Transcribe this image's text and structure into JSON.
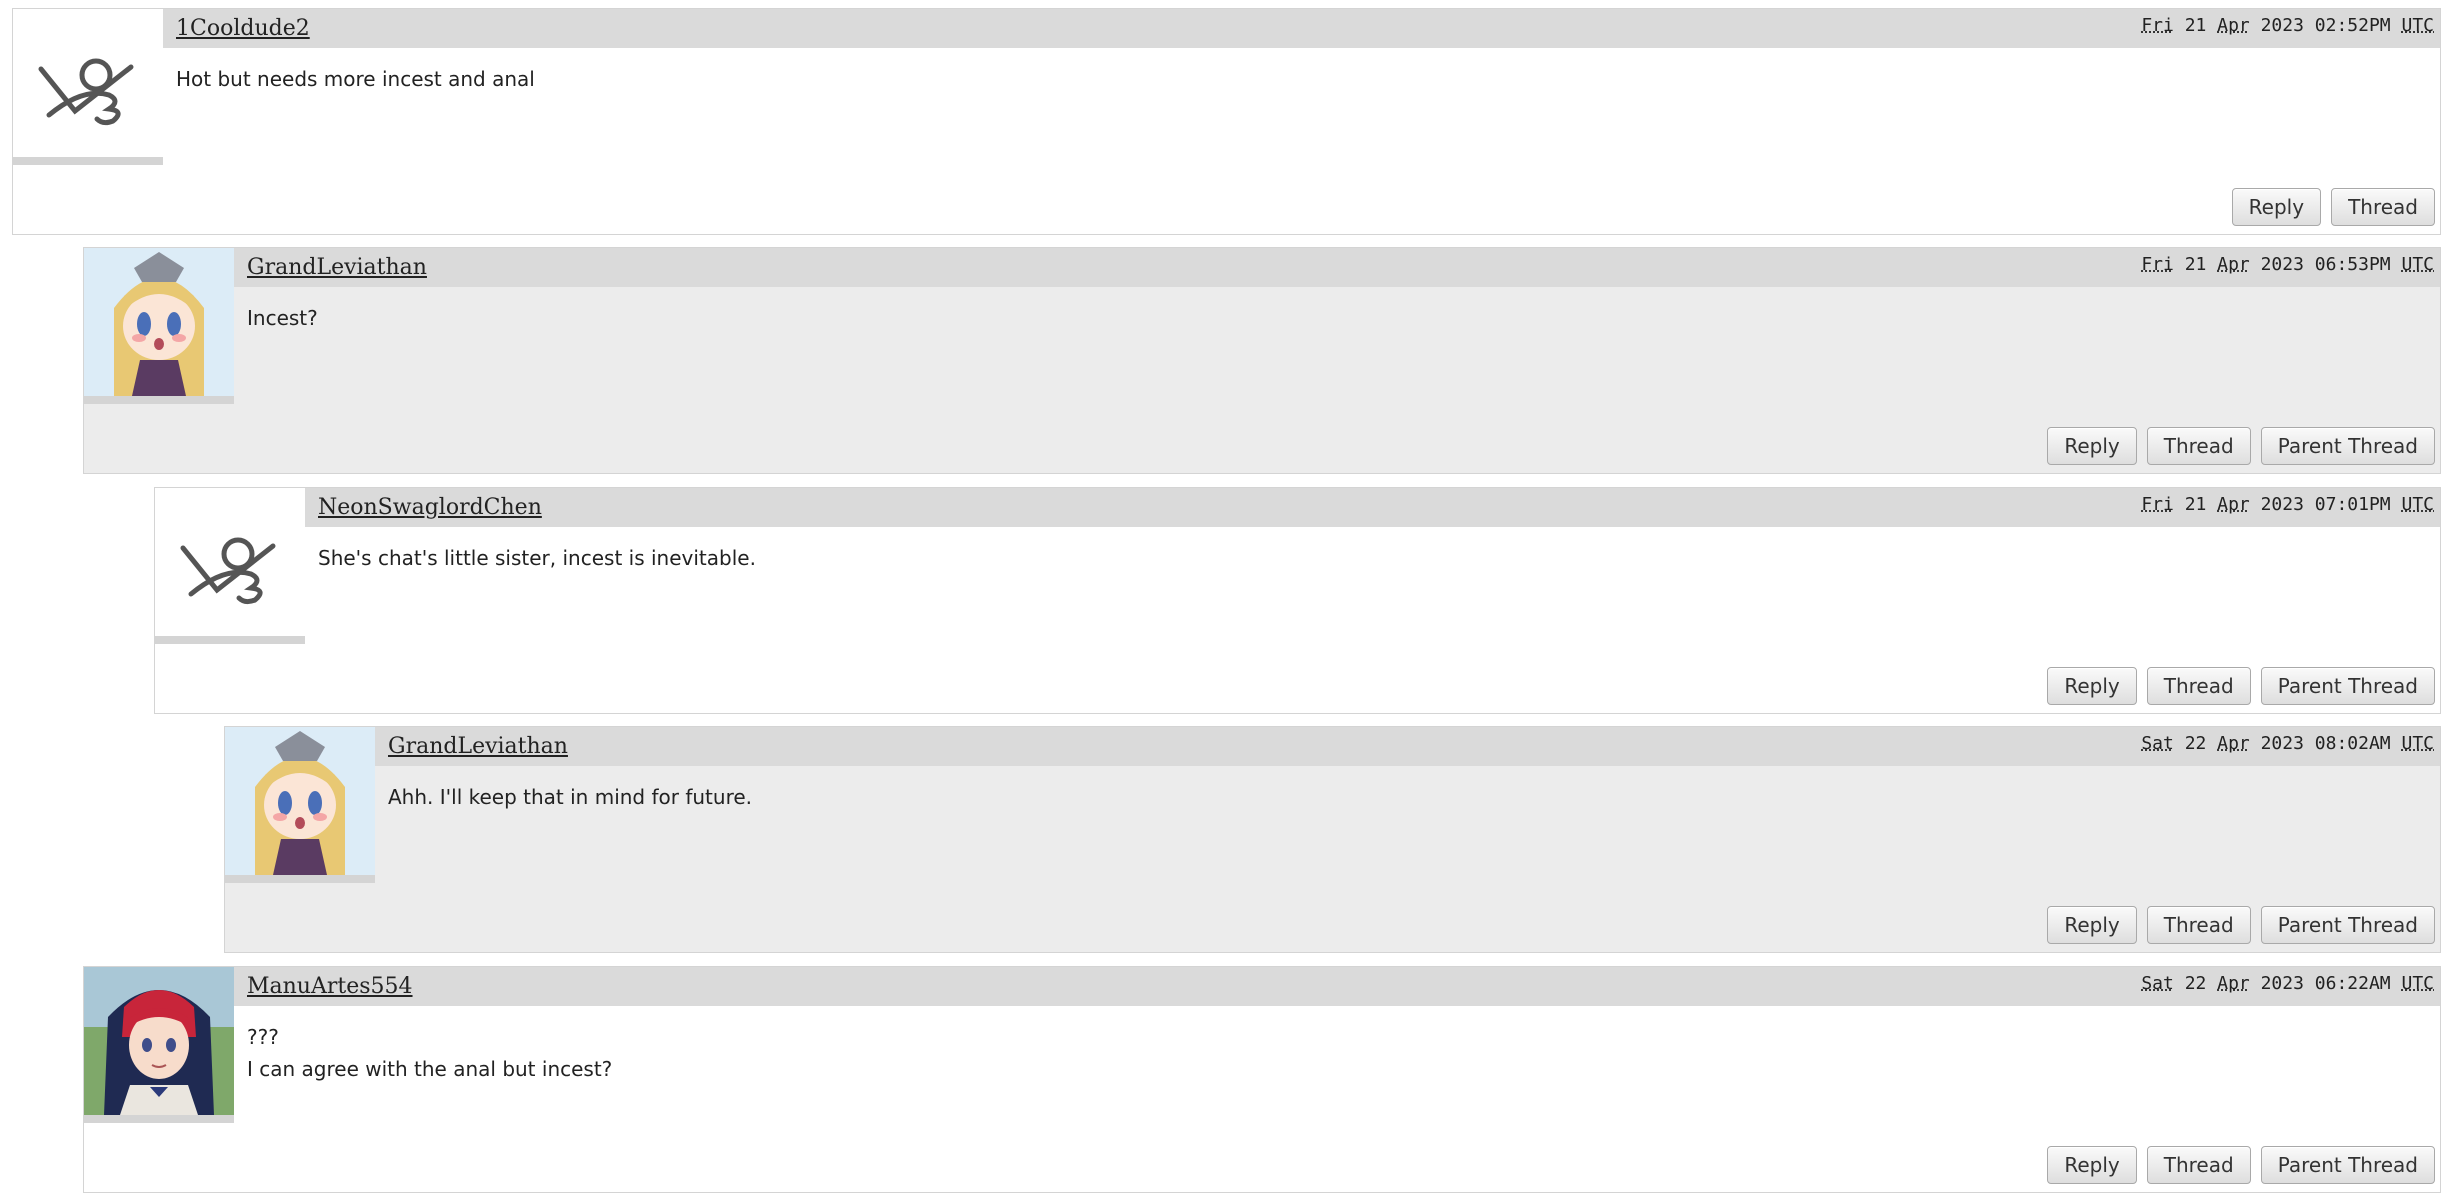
{
  "comments": [
    {
      "username": "1Cooldude2",
      "avatar": "default-avatar-icon",
      "timestamp": {
        "day": "Fri",
        "date": "21",
        "month": "Apr",
        "rest": "2023 02:52PM",
        "tz": "UTC"
      },
      "body": [
        "Hot but needs more incest and anal"
      ],
      "actions": {
        "reply": "Reply",
        "thread": "Thread"
      }
    },
    {
      "username": "GrandLeviathan",
      "avatar": "anime-avatar-blonde",
      "timestamp": {
        "day": "Fri",
        "date": "21",
        "month": "Apr",
        "rest": "2023 06:53PM",
        "tz": "UTC"
      },
      "body": [
        "Incest?"
      ],
      "actions": {
        "reply": "Reply",
        "thread": "Thread",
        "parent": "Parent Thread"
      }
    },
    {
      "username": "NeonSwaglordChen",
      "avatar": "default-avatar-icon",
      "timestamp": {
        "day": "Fri",
        "date": "21",
        "month": "Apr",
        "rest": "2023 07:01PM",
        "tz": "UTC"
      },
      "body": [
        "She's chat's little sister, incest is inevitable."
      ],
      "actions": {
        "reply": "Reply",
        "thread": "Thread",
        "parent": "Parent Thread"
      }
    },
    {
      "username": "GrandLeviathan",
      "avatar": "anime-avatar-blonde",
      "timestamp": {
        "day": "Sat",
        "date": "22",
        "month": "Apr",
        "rest": "2023 08:02AM",
        "tz": "UTC"
      },
      "body": [
        "Ahh. I'll keep that in mind for future."
      ],
      "actions": {
        "reply": "Reply",
        "thread": "Thread",
        "parent": "Parent Thread"
      }
    },
    {
      "username": "ManuArtes554",
      "avatar": "anime-avatar-redhair",
      "timestamp": {
        "day": "Sat",
        "date": "22",
        "month": "Apr",
        "rest": "2023 06:22AM",
        "tz": "UTC"
      },
      "body": [
        "???",
        "I can agree with the anal but incest?"
      ],
      "actions": {
        "reply": "Reply",
        "thread": "Thread",
        "parent": "Parent Thread"
      }
    }
  ]
}
